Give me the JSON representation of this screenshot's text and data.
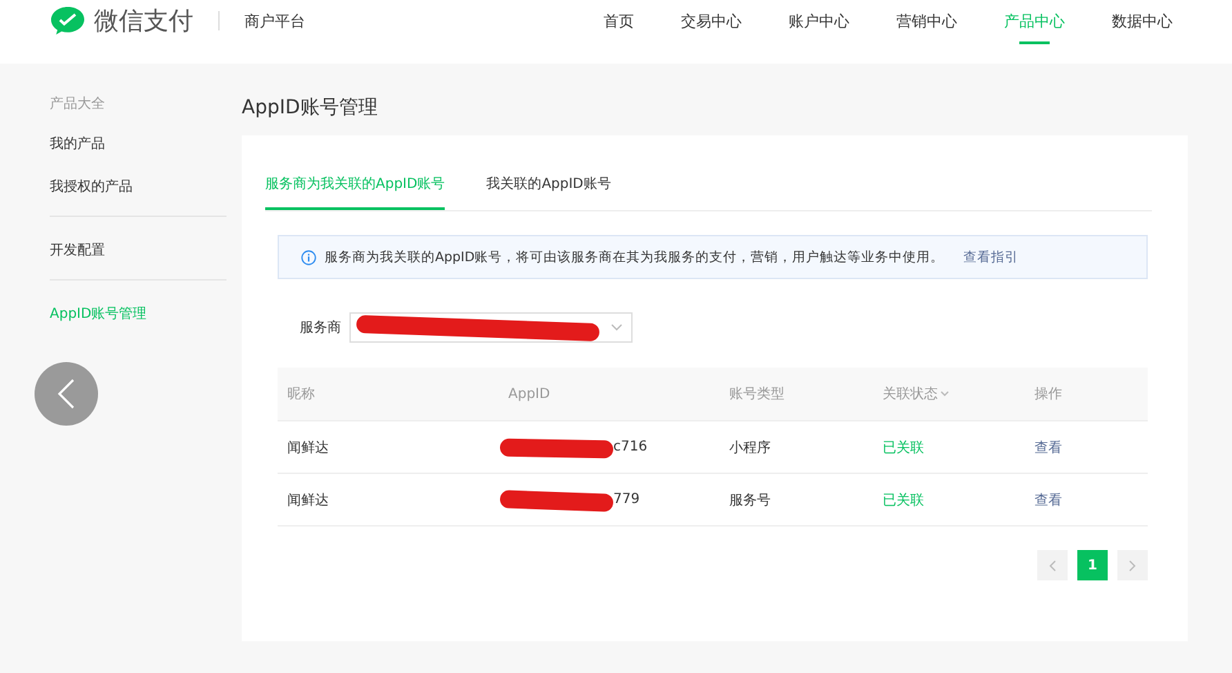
{
  "header": {
    "logo_text": "微信支付",
    "platform": "商户平台",
    "nav": [
      {
        "label": "首页",
        "selected": false
      },
      {
        "label": "交易中心",
        "selected": false
      },
      {
        "label": "账户中心",
        "selected": false
      },
      {
        "label": "营销中心",
        "selected": false
      },
      {
        "label": "产品中心",
        "selected": true
      },
      {
        "label": "数据中心",
        "selected": false
      }
    ]
  },
  "sidebar": {
    "heading": "产品大全",
    "groups": [
      [
        {
          "label": "我的产品",
          "selected": false
        },
        {
          "label": "我授权的产品",
          "selected": false
        }
      ],
      [
        {
          "label": "开发配置",
          "selected": false
        }
      ],
      [
        {
          "label": "AppID账号管理",
          "selected": true
        }
      ]
    ]
  },
  "page_title": "AppID账号管理",
  "tabs": [
    {
      "label": "服务商为我关联的AppID账号",
      "selected": true
    },
    {
      "label": "我关联的AppID账号",
      "selected": false
    }
  ],
  "notice": {
    "text": "服务商为我关联的AppID账号，将可由该服务商在其为我服务的支付，营销，用户触达等业务中使用。",
    "link": "查看指引"
  },
  "filter": {
    "label": "服务商"
  },
  "table": {
    "columns": [
      "昵称",
      "AppID",
      "账号类型",
      "关联状态",
      "操作"
    ],
    "rows": [
      {
        "nickname": "闻鲜达",
        "appid_tail": "c716",
        "type": "小程序",
        "status": "已关联",
        "action": "查看"
      },
      {
        "nickname": "闻鲜达",
        "appid_tail": "779",
        "type": "服务号",
        "status": "已关联",
        "action": "查看"
      }
    ]
  },
  "pagination": {
    "pages": [
      {
        "label": "1",
        "selected": true
      }
    ]
  }
}
